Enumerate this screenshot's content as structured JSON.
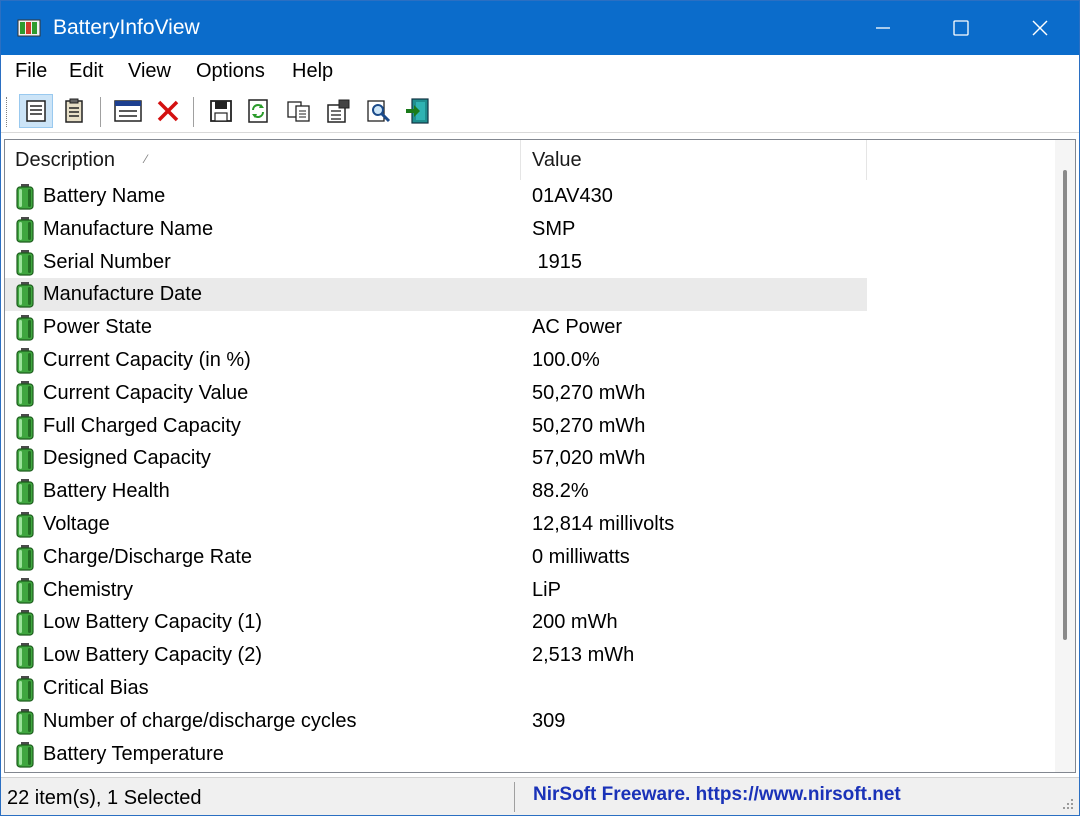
{
  "window": {
    "title": "BatteryInfoView",
    "accent_color": "#0b6ccb"
  },
  "menu": {
    "file": "File",
    "edit": "Edit",
    "view": "View",
    "options": "Options",
    "help": "Help"
  },
  "toolbar": {
    "icons": [
      "battery-info-mode-icon",
      "battery-log-mode-icon",
      "html-report-icon",
      "delete-icon",
      "save-icon",
      "refresh-icon",
      "copy-icon",
      "properties-icon",
      "find-icon",
      "exit-icon"
    ]
  },
  "list": {
    "columns": {
      "description": "Description",
      "value": "Value"
    },
    "rows": [
      {
        "description": "Battery Name",
        "value": "01AV430"
      },
      {
        "description": "Manufacture Name",
        "value": "SMP"
      },
      {
        "description": "Serial Number",
        "value": " 1915"
      },
      {
        "description": "Manufacture Date",
        "value": ""
      },
      {
        "description": "Power State",
        "value": "AC Power"
      },
      {
        "description": "Current Capacity (in %)",
        "value": "100.0%"
      },
      {
        "description": "Current Capacity Value",
        "value": "50,270 mWh"
      },
      {
        "description": "Full Charged Capacity",
        "value": "50,270 mWh"
      },
      {
        "description": "Designed Capacity",
        "value": "57,020 mWh"
      },
      {
        "description": "Battery Health",
        "value": "88.2%"
      },
      {
        "description": "Voltage",
        "value": "12,814 millivolts"
      },
      {
        "description": "Charge/Discharge Rate",
        "value": "0 milliwatts"
      },
      {
        "description": "Chemistry",
        "value": "LiP"
      },
      {
        "description": "Low Battery Capacity (1)",
        "value": "200 mWh"
      },
      {
        "description": "Low Battery Capacity (2)",
        "value": "2,513 mWh"
      },
      {
        "description": "Critical Bias",
        "value": ""
      },
      {
        "description": "Number of charge/discharge cycles",
        "value": "309"
      },
      {
        "description": "Battery Temperature",
        "value": ""
      }
    ],
    "selected_row": "Manufacture Date"
  },
  "status": {
    "items": "22 item(s), 1 Selected",
    "credit": "NirSoft Freeware. https://www.nirsoft.net",
    "credit_color": "#1a32b8"
  }
}
